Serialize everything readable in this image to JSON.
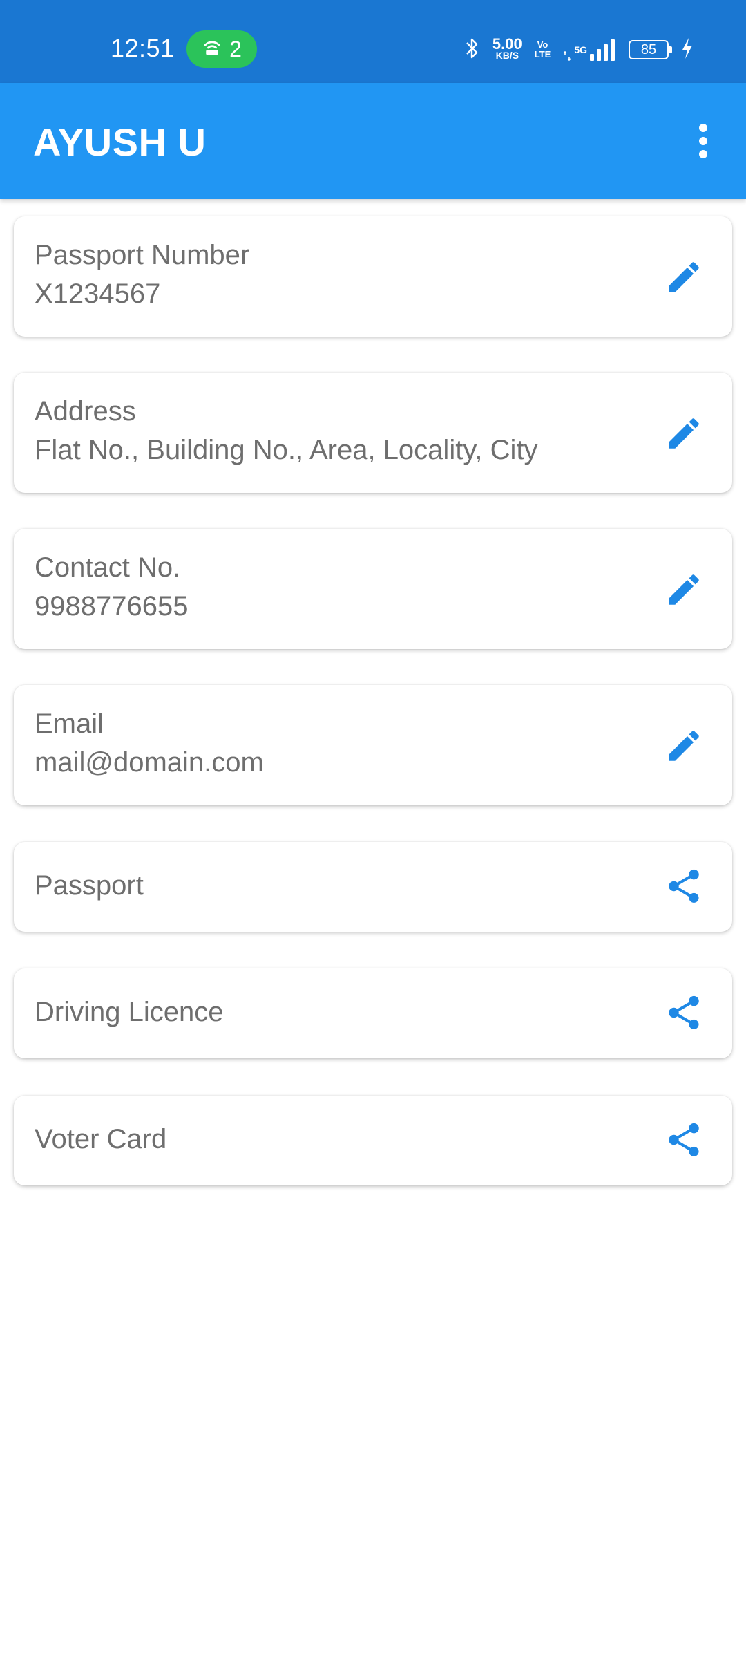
{
  "status_bar": {
    "time": "12:51",
    "hotspot_count": "2",
    "net_speed_value": "5.00",
    "net_speed_unit": "KB/S",
    "volte_top": "Vo",
    "volte_bottom": "LTE",
    "network_type": "5G",
    "battery_level": "85",
    "background_color": "#1a77d2",
    "hotspot_color": "#2bc35a"
  },
  "app_bar": {
    "title": "AYUSH U",
    "background_color": "#2196f3",
    "menu_icon": "more-vert-icon"
  },
  "info_cards": [
    {
      "label": "Passport Number",
      "value": "X1234567",
      "action_icon": "edit-icon"
    },
    {
      "label": "Address",
      "value": "Flat No., Building No., Area, Locality, City",
      "action_icon": "edit-icon"
    },
    {
      "label": "Contact No.",
      "value": "9988776655",
      "action_icon": "edit-icon"
    },
    {
      "label": "Email",
      "value": "mail@domain.com",
      "action_icon": "edit-icon"
    }
  ],
  "document_cards": [
    {
      "label": "Passport",
      "action_icon": "share-icon"
    },
    {
      "label": "Driving Licence",
      "action_icon": "share-icon"
    },
    {
      "label": "Voter Card",
      "action_icon": "share-icon"
    }
  ],
  "colors": {
    "accent": "#2196f3",
    "icon": "#1e88e5",
    "text": "#6e6e6e"
  }
}
